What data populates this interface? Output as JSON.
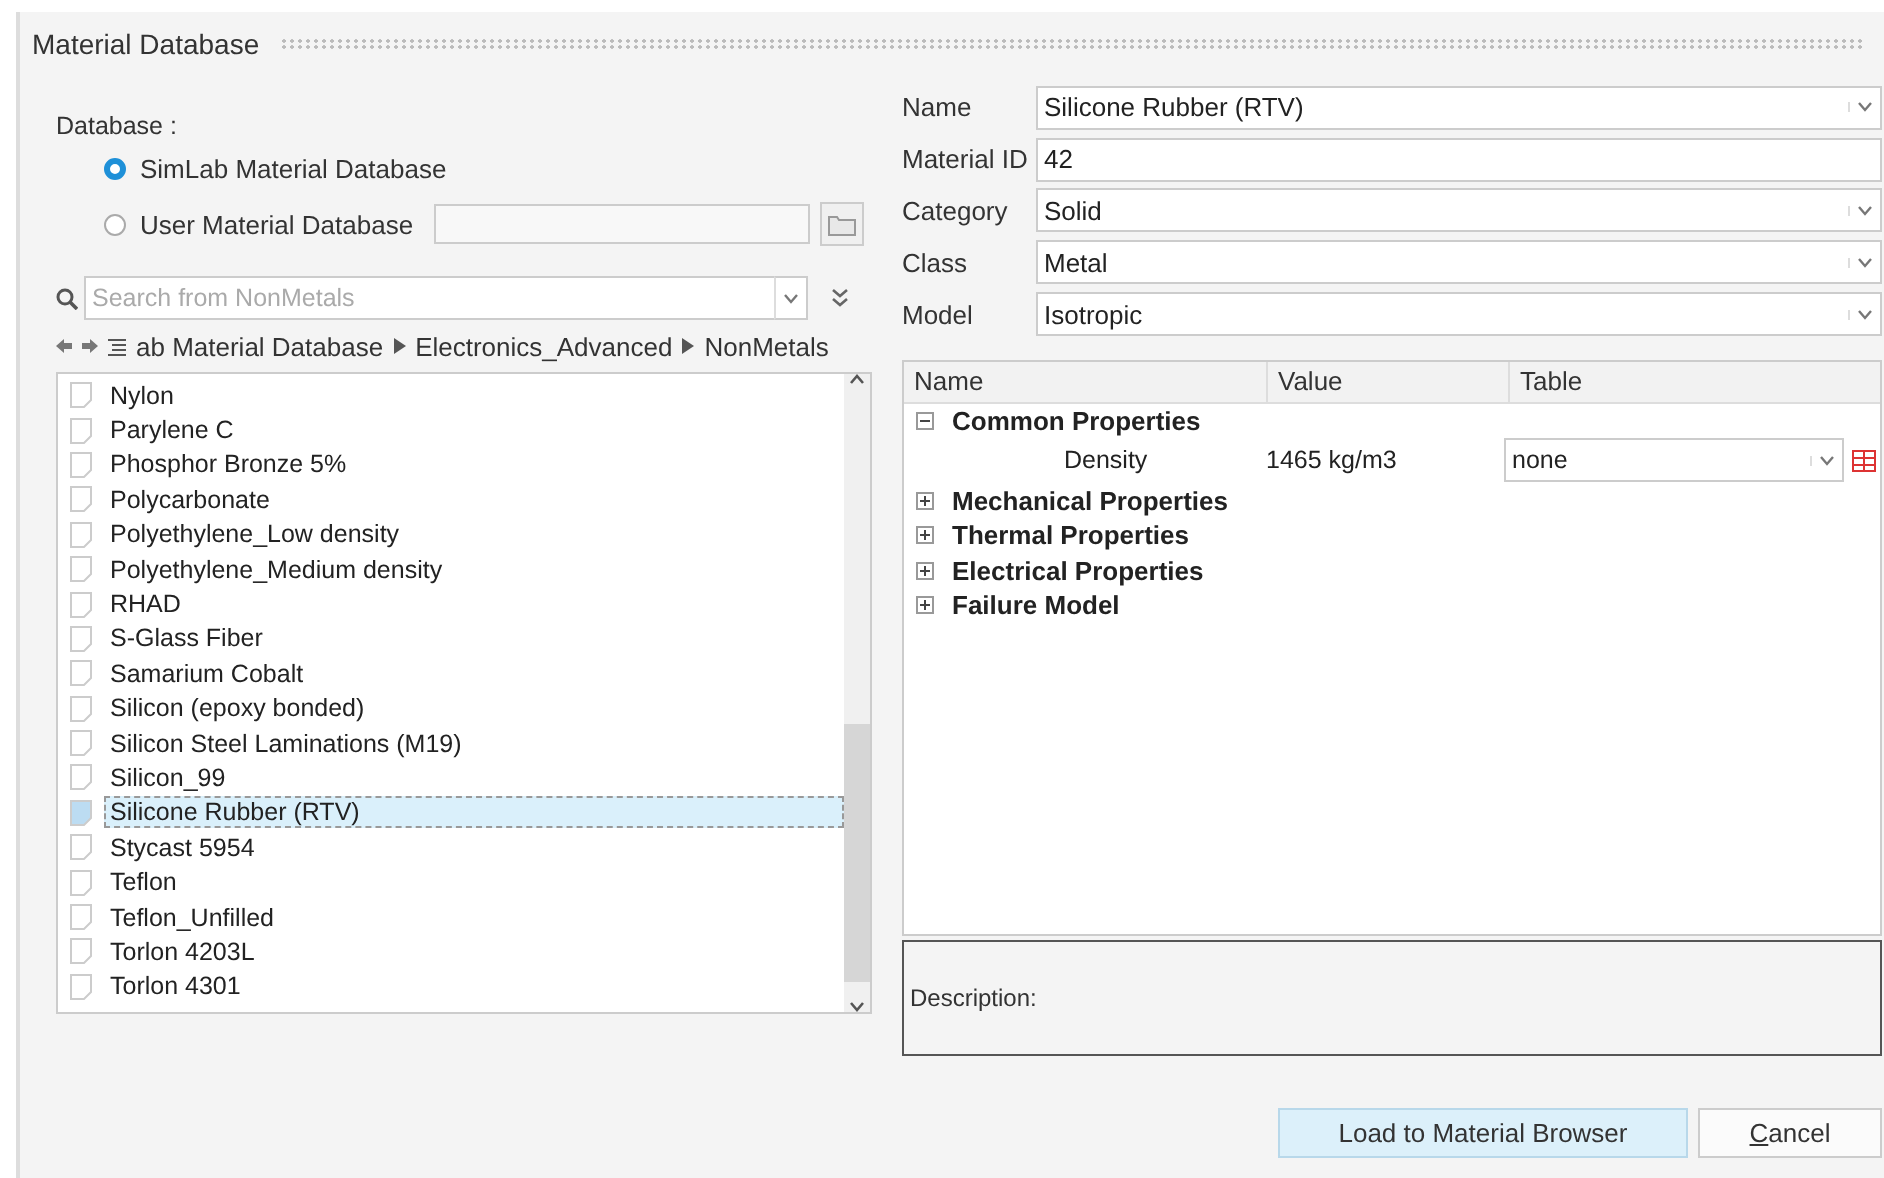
{
  "window": {
    "title": "Material Database"
  },
  "database": {
    "label": "Database :",
    "options": [
      {
        "label": "SimLab Material Database",
        "selected": true,
        "has_path": false
      },
      {
        "label": "User Material Database",
        "selected": false,
        "has_path": true
      }
    ]
  },
  "search": {
    "placeholder": "Search from NonMetals"
  },
  "breadcrumb": [
    "ab Material Database",
    "Electronics_Advanced",
    "NonMetals"
  ],
  "materials": [
    {
      "label": "Nylon",
      "selected": false
    },
    {
      "label": "Parylene C",
      "selected": false
    },
    {
      "label": "Phosphor Bronze 5%",
      "selected": false
    },
    {
      "label": "Polycarbonate",
      "selected": false
    },
    {
      "label": "Polyethylene_Low density",
      "selected": false
    },
    {
      "label": "Polyethylene_Medium density",
      "selected": false
    },
    {
      "label": "RHAD",
      "selected": false
    },
    {
      "label": "S-Glass Fiber",
      "selected": false
    },
    {
      "label": "Samarium Cobalt",
      "selected": false
    },
    {
      "label": "Silicon (epoxy bonded)",
      "selected": false
    },
    {
      "label": "Silicon Steel Laminations (M19)",
      "selected": false
    },
    {
      "label": "Silicon_99",
      "selected": false
    },
    {
      "label": "Silicone Rubber (RTV)",
      "selected": true
    },
    {
      "label": "Stycast 5954",
      "selected": false
    },
    {
      "label": "Teflon",
      "selected": false
    },
    {
      "label": "Teflon_Unfilled",
      "selected": false
    },
    {
      "label": "Torlon 4203L",
      "selected": false
    },
    {
      "label": "Torlon 4301",
      "selected": false
    }
  ],
  "form": [
    {
      "label": "Name",
      "value": "Silicone Rubber (RTV)",
      "kind": "dropdown"
    },
    {
      "label": "Material ID",
      "value": "42",
      "kind": "text"
    },
    {
      "label": "Category",
      "value": "Solid",
      "kind": "dropdown"
    },
    {
      "label": "Class",
      "value": "Metal",
      "kind": "dropdown"
    },
    {
      "label": "Model",
      "value": "Isotropic",
      "kind": "dropdown"
    }
  ],
  "properties": {
    "columns": [
      "Name",
      "Value",
      "Table"
    ],
    "groups": [
      {
        "label": "Common Properties",
        "expanded": true,
        "children": [
          {
            "label": "Density",
            "value": "1465 kg/m3",
            "table": "none"
          }
        ]
      },
      {
        "label": "Mechanical Properties",
        "expanded": false
      },
      {
        "label": "Thermal Properties",
        "expanded": false
      },
      {
        "label": "Electrical Properties",
        "expanded": false
      },
      {
        "label": "Failure Model",
        "expanded": false
      }
    ]
  },
  "description": {
    "label": "Description:"
  },
  "buttons": [
    {
      "label": "Load to Material Browser",
      "kind": "primary"
    },
    {
      "label": "Cancel",
      "kind": "normal",
      "underline_first": true
    }
  ]
}
